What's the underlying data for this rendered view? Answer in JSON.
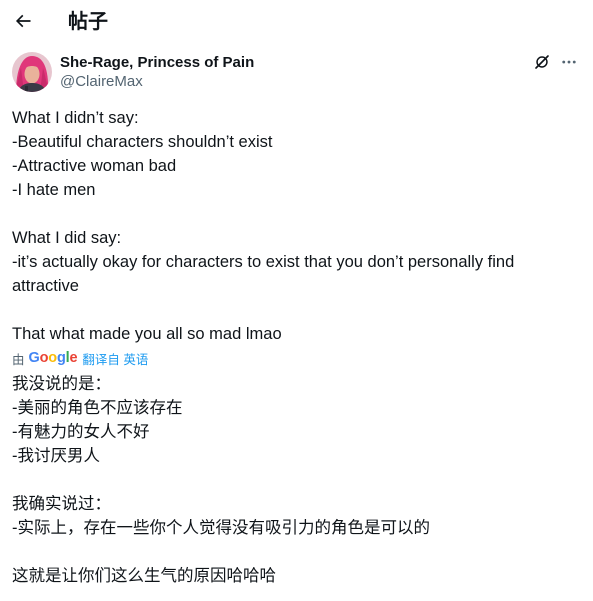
{
  "header": {
    "title": "帖子"
  },
  "author": {
    "display_name": "She-Rage, Princess of Pain",
    "handle": "@ClaireMax"
  },
  "tweet": {
    "original_text": "What I didn’t say:\n-Beautiful characters shouldn’t exist\n-Attractive woman bad\n-I hate men\n\nWhat I did say:\n-it’s actually okay for characters to exist that you don’t personally find attractive\n\nThat what made you all so mad lmao",
    "translated_text": "我没说的是：\n-美丽的角色不应该存在\n-有魅力的女人不好\n-我讨厌男人\n\n我确实说过：\n-实际上，存在一些你个人觉得没有吸引力的角色是可以的\n\n这就是让你们这么生气的原因哈哈哈"
  },
  "translation": {
    "by_label": "由",
    "provider": [
      "G",
      "o",
      "o",
      "g",
      "l",
      "e"
    ],
    "provider_colors": [
      "#4285F4",
      "#EA4335",
      "#FBBC05",
      "#4285F4",
      "#34A853",
      "#EA4335"
    ],
    "link_label": "翻译自 英语"
  },
  "icons": {
    "back": "arrow-left-icon",
    "grok": "grok-icon",
    "more": "more-horizontal-icon"
  },
  "colors": {
    "text_primary": "#0f1419",
    "text_secondary": "#536471",
    "link": "#1d9bf0"
  }
}
